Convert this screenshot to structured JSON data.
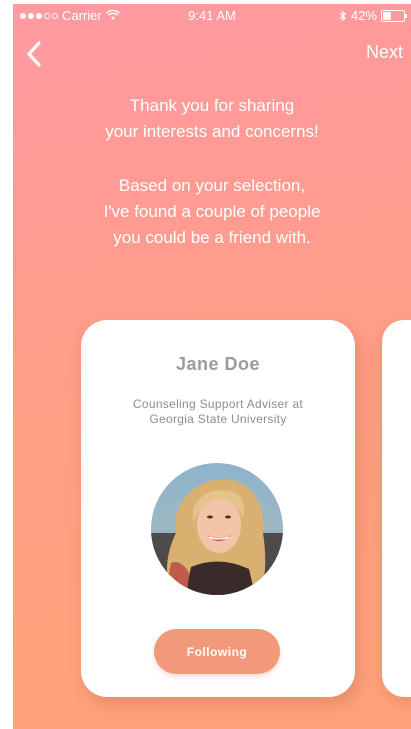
{
  "status_bar": {
    "carrier": "Carrier",
    "time": "9:41 AM",
    "battery": "42%",
    "battery_level": 0.42
  },
  "nav": {
    "back_icon": "chevron-left-icon",
    "next_label": "Next"
  },
  "intro": {
    "line1": "Thank you for sharing",
    "line2": "your interests and concerns!",
    "line3": "Based on your selection,",
    "line4": "I've found a couple of people",
    "line5": "you could be a friend with."
  },
  "card": {
    "name": "Jane Doe",
    "title_line1": "Counseling Support Adviser at",
    "title_line2": "Georgia State University",
    "button_label": "Following"
  },
  "colors": {
    "gradient_top": "#ff9aa2",
    "gradient_bottom": "#ffa37a",
    "button": "#f2997c",
    "card": "#ffffff"
  }
}
